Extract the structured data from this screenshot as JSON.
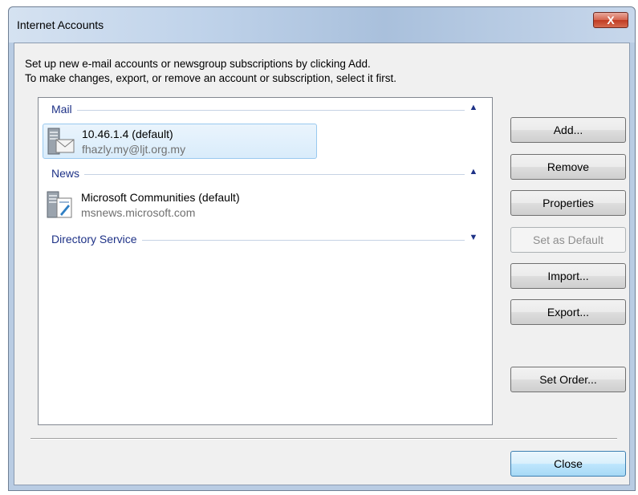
{
  "window": {
    "title": "Internet Accounts",
    "close_glyph": "X"
  },
  "intro": {
    "line1": "Set up new e-mail accounts or newsgroup subscriptions by clicking Add.",
    "line2": "To make changes, export, or remove an account or subscription, select it first."
  },
  "list": {
    "groups": [
      {
        "label": "Mail",
        "expanded": true,
        "accounts": [
          {
            "name": "10.46.1.4 (default)",
            "detail": "fhazly.my@ljt.org.my",
            "icon": "mail-server-icon",
            "selected": true
          }
        ]
      },
      {
        "label": "News",
        "expanded": true,
        "accounts": [
          {
            "name": "Microsoft Communities (default)",
            "detail": "msnews.microsoft.com",
            "icon": "news-server-icon",
            "selected": false
          }
        ]
      },
      {
        "label": "Directory Service",
        "expanded": false,
        "accounts": []
      }
    ]
  },
  "buttons": {
    "add": "Add...",
    "remove": "Remove",
    "properties": "Properties",
    "set_default": "Set as Default",
    "import": "Import...",
    "export": "Export...",
    "set_order": "Set Order...",
    "close": "Close"
  },
  "colors": {
    "group_header": "#1e3287",
    "selection_border": "#99c9ef",
    "close_button": "#c03b22"
  }
}
